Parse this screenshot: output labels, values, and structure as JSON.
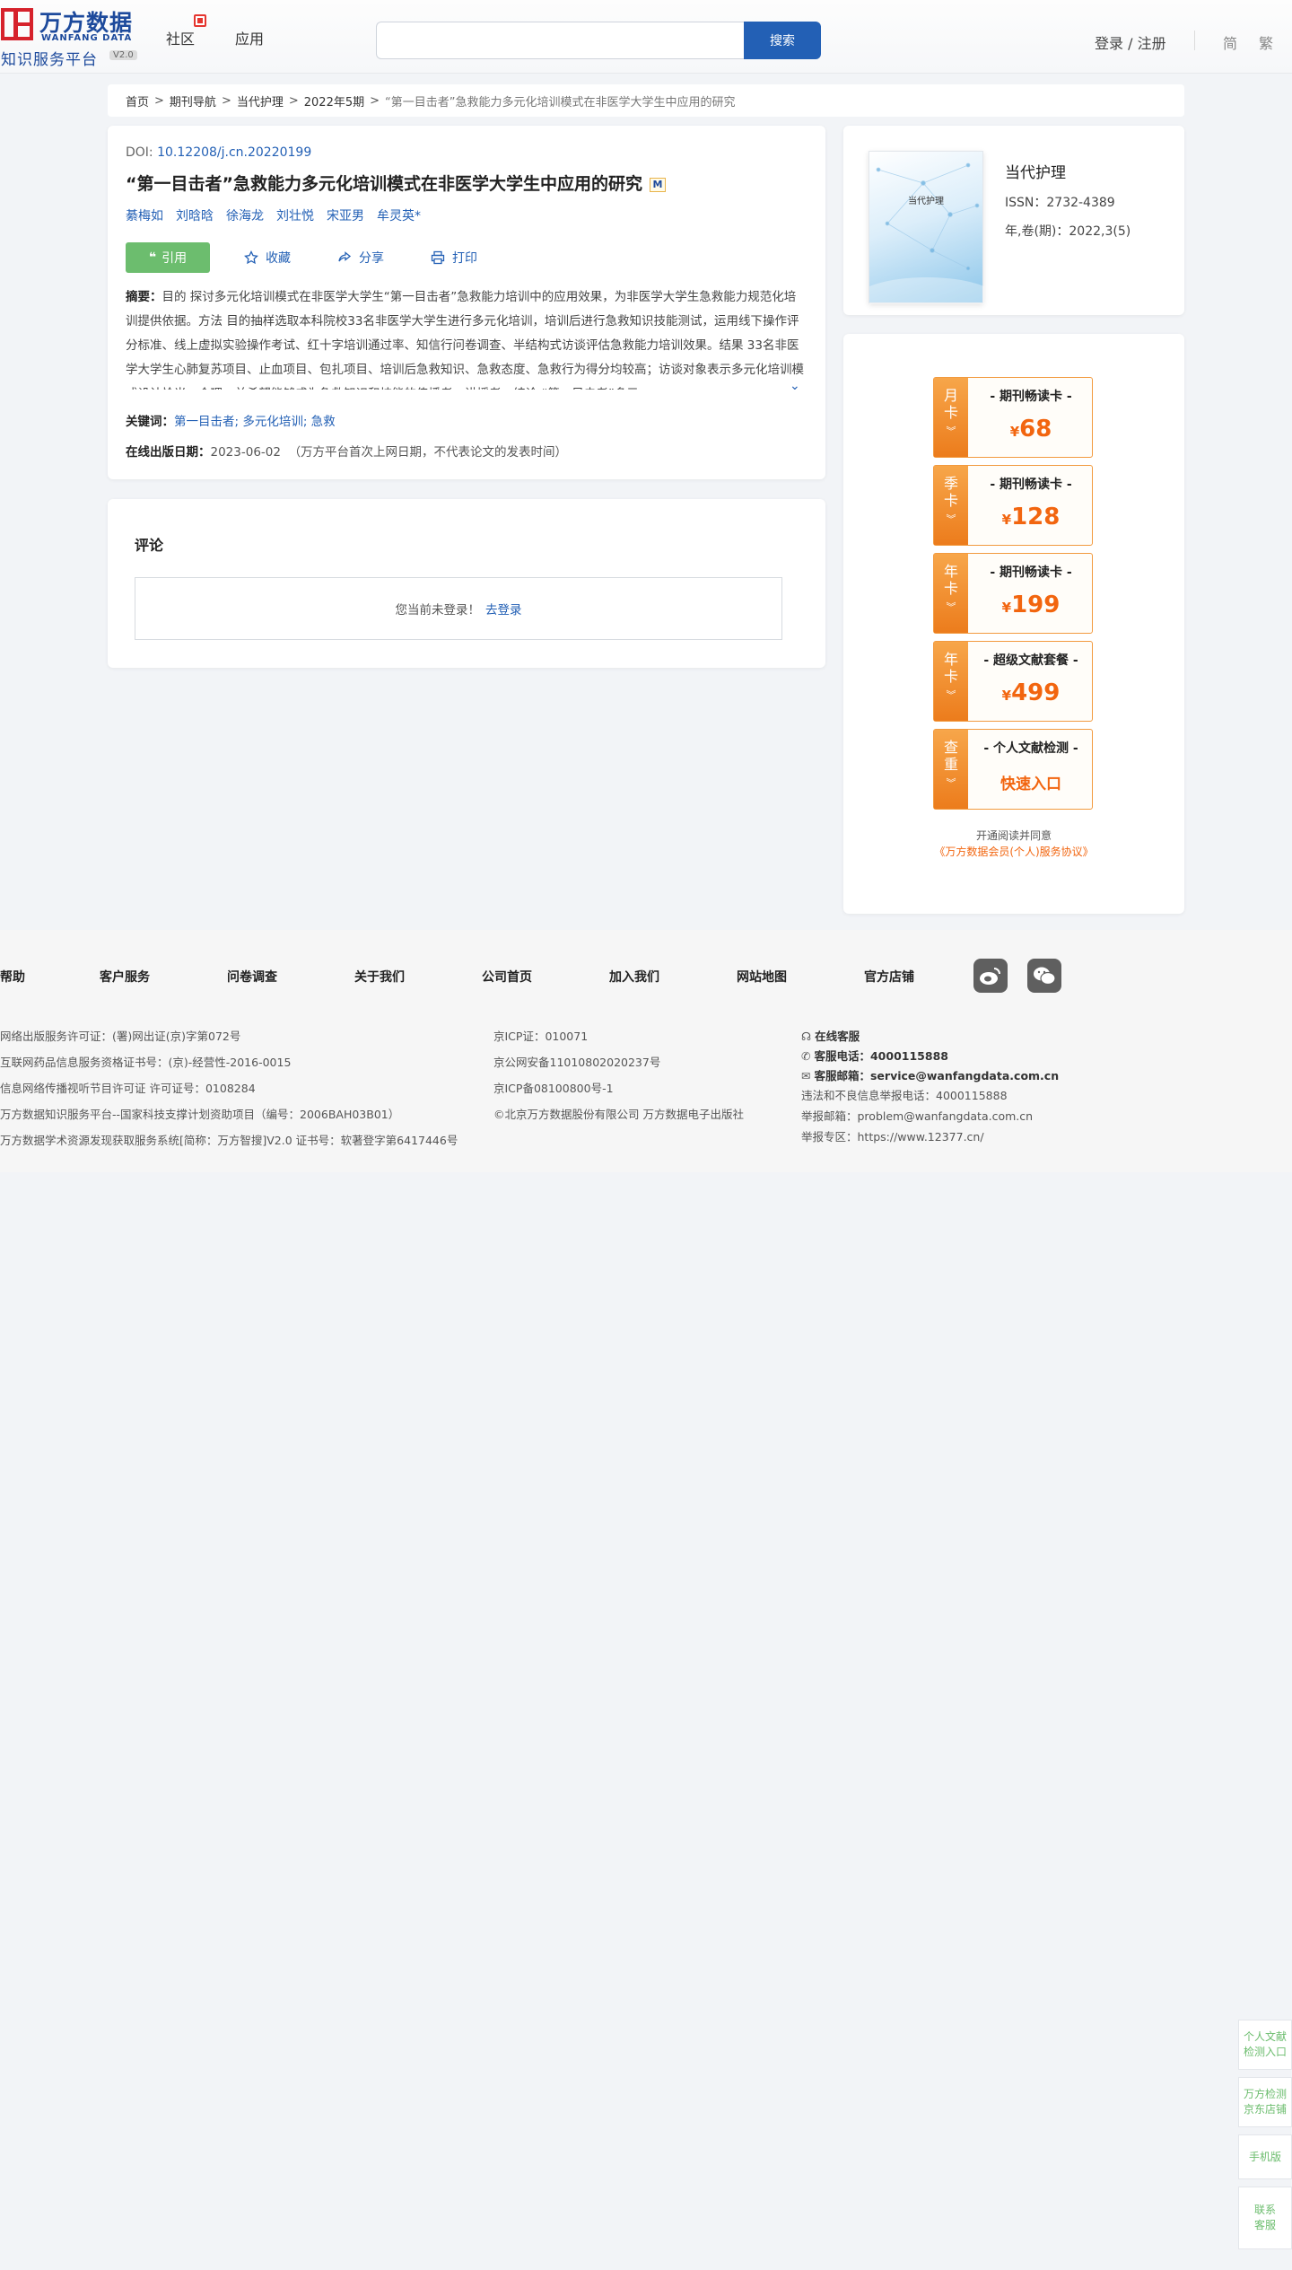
{
  "header": {
    "logo_cn": "万方数据",
    "logo_en": "WANFANG DATA",
    "logo_sub": "知识服务平台",
    "logo_version": "V2.0",
    "nav": [
      "社区",
      "应用"
    ],
    "search_placeholder": "",
    "search_button": "搜索",
    "login": "登录 / 注册",
    "lang_simplified": "简",
    "lang_traditional": "繁"
  },
  "breadcrumb": {
    "items": [
      "首页",
      "期刊导航",
      "当代护理",
      "2022年5期"
    ],
    "sep": ">",
    "current": "“第一目击者”急救能力多元化培训模式在非医学大学生中应用的研究"
  },
  "article": {
    "doi_label": "DOI: ",
    "doi": "10.12208/j.cn.20220199",
    "title": "“第一目击者”急救能力多元化培训模式在非医学大学生中应用的研究",
    "m_badge": "M",
    "authors": [
      "綦梅如",
      "刘晗晗",
      "徐海龙",
      "刘壮悦",
      "宋亚男",
      "牟灵英*"
    ],
    "cite": "引用",
    "actions": [
      "收藏",
      "分享",
      "打印"
    ],
    "abstract_label": "摘要：",
    "abstract": "目的 探讨多元化培训模式在非医学大学生“第一目击者”急救能力培训中的应用效果，为非医学大学生急救能力规范化培训提供依据。方法 目的抽样选取本科院校33名非医学大学生进行多元化培训，培训后进行急救知识技能测试，运用线下操作评分标准、线上虚拟实验操作考试、红十字培训通过率、知信行问卷调查、半结构式访谈评估急救能力培训效果。结果 33名非医学大学生心肺复苏项目、止血项目、包扎项目、培训后急救知识、急救态度、急救行为得分均较高；访谈对象表示多元化培训模式设计恰当、合理，并希望能够成为急救知识和技能的传播者、讲授者。结论 “第一目击者”多元...",
    "keywords_label": "关键词：",
    "keywords": "第一目击者; 多元化培训; 急救",
    "pubdate_label": "在线出版日期：",
    "pubdate": "2023-06-02",
    "pubdate_note": "（万方平台首次上网日期，不代表论文的发表时间）"
  },
  "comments": {
    "title": "评论",
    "not_logged": "您当前未登录！",
    "login_link": "去登录"
  },
  "journal": {
    "cover_title": "当代护理",
    "name": "当代护理",
    "issn": "ISSN：2732-4389",
    "volume": "年,卷(期)：2022,3(5)"
  },
  "member": {
    "offers": [
      {
        "side": [
          "月",
          "卡"
        ],
        "name": "- 期刊畅读卡 -",
        "currency": "¥",
        "price": "68"
      },
      {
        "side": [
          "季",
          "卡"
        ],
        "name": "- 期刊畅读卡 -",
        "currency": "¥",
        "price": "128"
      },
      {
        "side": [
          "年",
          "卡"
        ],
        "name": "- 期刊畅读卡 -",
        "currency": "¥",
        "price": "199"
      },
      {
        "side": [
          "年",
          "卡"
        ],
        "name": "- 超级文献套餐 -",
        "currency": "¥",
        "price": "499"
      },
      {
        "side": [
          "查",
          "重"
        ],
        "name": "- 个人文献检测 -",
        "text": "快速入口"
      }
    ],
    "agree_text": "开通阅读并同意",
    "agree_link": "《万方数据会员(个人)服务协议》"
  },
  "footer": {
    "links": [
      "帮助",
      "客户服务",
      "问卷调查",
      "关于我们",
      "公司首页",
      "加入我们",
      "网站地图",
      "官方店铺"
    ],
    "col1": [
      "网络出版服务许可证：(署)网出证(京)字第072号",
      "互联网药品信息服务资格证书号：(京)-经营性-2016-0015",
      "信息网络传播视听节目许可证 许可证号：0108284",
      "万方数据知识服务平台--国家科技支撑计划资助项目（编号：2006BAH03B01）",
      "万方数据学术资源发现获取服务系统[简称：万方智搜]V2.0 证书号：软著登字第6417446号"
    ],
    "col2": [
      "京ICP证：010071",
      "京公网安备11010802020237号",
      "京ICP备08100800号-1",
      "©北京万方数据股份有限公司 万方数据电子出版社"
    ],
    "col3": {
      "online_service": "在线客服",
      "phone_label": "客服电话：",
      "phone": "4000115888",
      "email_label": "客服邮箱：",
      "email": "service@wanfangdata.com.cn",
      "report_phone": "违法和不良信息举报电话：4000115888",
      "report_email": "举报邮箱：problem@wanfangdata.com.cn",
      "report_zone": "举报专区：https://www.12377.cn/"
    }
  },
  "side": {
    "check": [
      "个人文献",
      "检测入口"
    ],
    "jd": [
      "万方检测",
      "京东店铺"
    ],
    "mobile": "手机版",
    "contact": [
      "联系",
      "客服"
    ]
  },
  "colors": {
    "brand_blue": "#2360b5",
    "green": "#6cbd6e",
    "orange": "#f2650f"
  }
}
